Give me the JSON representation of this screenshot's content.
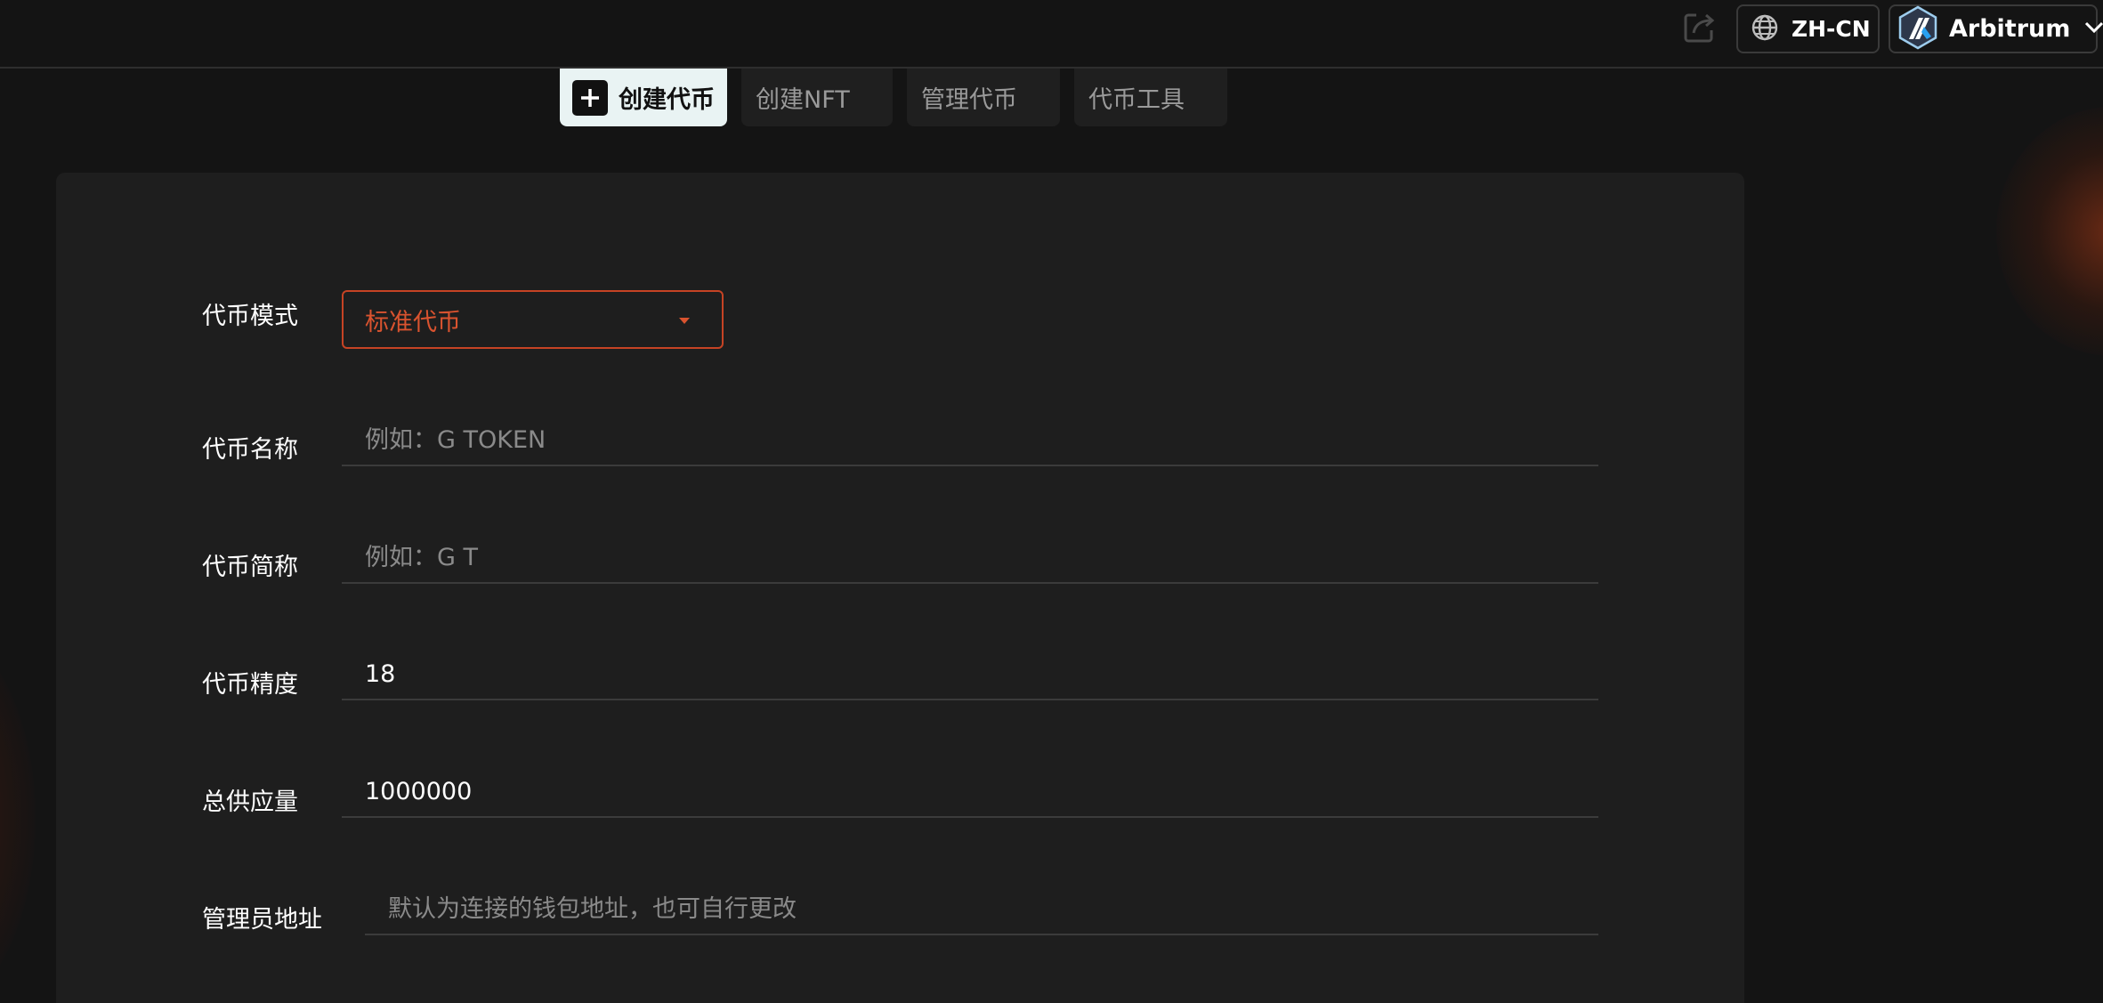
{
  "header": {
    "share_icon": "share-icon",
    "language": {
      "icon": "globe-icon",
      "label": "ZH-CN"
    },
    "network": {
      "icon": "arbitrum-logo",
      "label": "Arbitrum",
      "chevron_icon": "chevron-down-icon"
    }
  },
  "tabs": [
    {
      "label": "创建代币",
      "icon": "plus-icon",
      "active": true
    },
    {
      "label": "创建NFT",
      "active": false
    },
    {
      "label": "管理代币",
      "active": false
    },
    {
      "label": "代币工具",
      "active": false
    }
  ],
  "form": {
    "mode": {
      "label": "代币模式",
      "selected": "标准代币"
    },
    "name": {
      "label": "代币名称",
      "placeholder": "例如：G TOKEN",
      "value": ""
    },
    "symbol": {
      "label": "代币简称",
      "placeholder": "例如：G T",
      "value": ""
    },
    "decimals": {
      "label": "代币精度",
      "value": "18"
    },
    "supply": {
      "label": "总供应量",
      "value": "1000000"
    },
    "admin": {
      "label": "管理员地址",
      "placeholder": "默认为连接的钱包地址，也可自行更改",
      "value": ""
    }
  },
  "colors": {
    "background": "#141414",
    "card": "#1e1e1e",
    "accent": "#d9532f",
    "active_tab": "#e9f3f3"
  }
}
